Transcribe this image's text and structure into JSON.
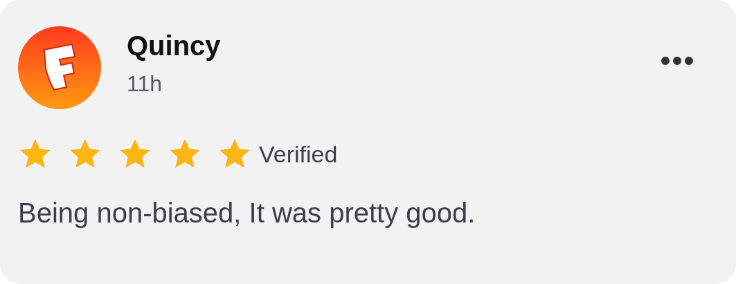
{
  "review": {
    "author": "Quincy",
    "time": "11h",
    "stars": 5,
    "verified_label": "Verified",
    "text": "Being non-biased, It was pretty good."
  }
}
